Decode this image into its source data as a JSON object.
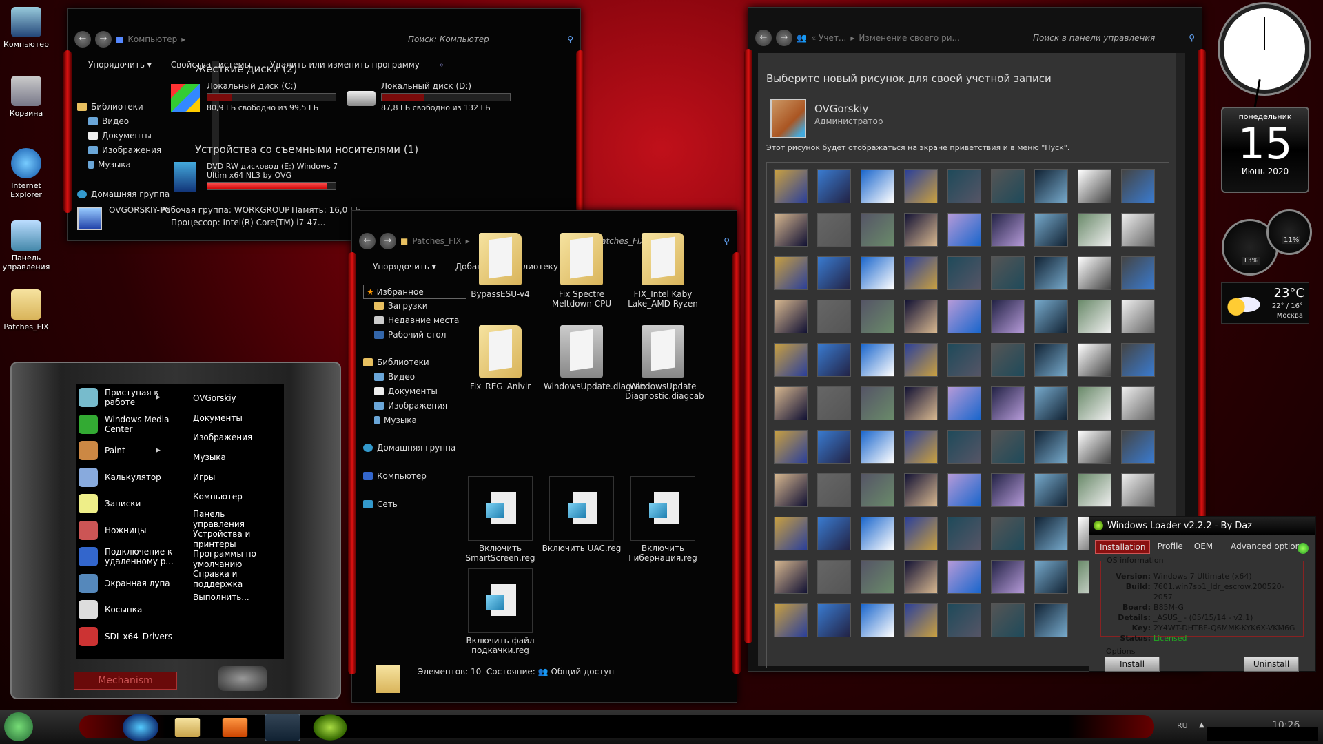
{
  "desktop": {
    "icons": [
      {
        "label": "Компьютер"
      },
      {
        "label": "Корзина"
      },
      {
        "label": "Internet Explorer"
      },
      {
        "label": "Панель управления"
      },
      {
        "label": "Patches_FIX"
      }
    ]
  },
  "computer_window": {
    "breadcrumb": "Компьютер",
    "search_placeholder": "Поиск: Компьютер",
    "toolbar": [
      "Упорядочить ▾",
      "Свойства системы",
      "Удалить или изменить программу",
      "»"
    ],
    "nav": {
      "libraries": "Библиотеки",
      "items": [
        "Видео",
        "Документы",
        "Изображения",
        "Музыка"
      ],
      "homegroup": "Домашняя группа"
    },
    "hard_drives_header": "Жесткие диски (2)",
    "drives": [
      {
        "name": "Локальный диск (C:)",
        "free": "80,9 ГБ свободно из 99,5 ГБ",
        "used_percent": 19
      },
      {
        "name": "Локальный диск (D:)",
        "free": "87,8 ГБ свободно из 132 ГБ",
        "used_percent": 33
      }
    ],
    "removable_header": "Устройства со съемными носителями (1)",
    "dvd": {
      "name": "DVD RW дисковод (E:) Windows 7",
      "name2": "Ultim x64 NL3 by OVG",
      "used_percent": 93
    },
    "details": {
      "pc": "OVGORSKIY-PC",
      "workgroup": "Рабочая группа:  WORKGROUP",
      "memory": "Память: 16,0 ГБ",
      "cpu": "Процессор: Intel(R) Core(TM) i7-47..."
    }
  },
  "start_menu": {
    "programs": [
      "Приступая к работе",
      "Windows Media Center",
      "Paint",
      "Калькулятор",
      "Записки",
      "Ножницы",
      "Подключение к удаленному р...",
      "Экранная лупа",
      "Косынка",
      "SDI_x64_Drivers"
    ],
    "places": [
      "OVGorskiy",
      "Документы",
      "Изображения",
      "Музыка",
      "Игры",
      "Компьютер",
      "Панель управления",
      "Устройства и принтеры",
      "Программы по умолчанию",
      "Справка и поддержка",
      "Выполнить..."
    ],
    "theme_label": "Mechanism"
  },
  "patches_window": {
    "breadcrumb": "Patches_FIX",
    "search_placeholder": "Поиск: Patches_FIX",
    "toolbar": [
      "Упорядочить ▾",
      "Добавить в библиотеку ▾",
      "»"
    ],
    "nav": {
      "favorites": "Избранное",
      "fav_items": [
        "Загрузки",
        "Недавние места",
        "Рабочий стол"
      ],
      "libraries": "Библиотеки",
      "lib_items": [
        "Видео",
        "Документы",
        "Изображения",
        "Музыка"
      ],
      "homegroup": "Домашняя группа",
      "computer": "Компьютер",
      "network": "Сеть"
    },
    "folders": [
      "BypassESU-v4",
      "Fix Spectre Meltdown CPU",
      "FIX_Intel Kaby Lake_AMD Ryzen",
      "Fix_REG_Anivir",
      "WindowsUpdate.diagcab",
      "WindowsUpdate Diagnostic.diagcab"
    ],
    "reg_files": [
      "Включить SmartScreen.reg",
      "Включить UAC.reg",
      "Включить Гибернация.reg",
      "Включить файл подкачки.reg"
    ],
    "status": {
      "count": "Элементов: 10",
      "state_label": "Состояние:",
      "state": "Общий доступ"
    }
  },
  "control_panel": {
    "breadcrumb": [
      "«  Учет...",
      "Изменение своего ри..."
    ],
    "search_placeholder": "Поиск в панели управления",
    "heading": "Выберите новый рисунок для своей учетной записи",
    "user": {
      "name": "OVGorskiy",
      "role": "Администратор"
    },
    "note": "Этот рисунок будет отображаться на экране приветствия и в меню \"Пуск\".",
    "picture_count": 97
  },
  "windows_loader": {
    "title": "Windows Loader v2.2.2 - By Daz",
    "tabs": [
      "Installation",
      "Profile",
      "OEM",
      "Advanced options"
    ],
    "active_tab": "Installation",
    "os_group": "OS information",
    "fields": [
      {
        "k": "Version:",
        "v": "Windows 7 Ultimate (x64)"
      },
      {
        "k": "Build:",
        "v": "7601.win7sp1_ldr_escrow.200520-2057"
      },
      {
        "k": "Board:",
        "v": "B85M-G"
      },
      {
        "k": "Details:",
        "v": "_ASUS_ - (05/15/14 - v2.1)"
      },
      {
        "k": "Key:",
        "v": "2Y4WT-DHTBF-Q6MMK-KYK6X-VKM6G"
      },
      {
        "k": "Status:",
        "v": "Licensed"
      }
    ],
    "options_group": "Options",
    "install": "Install",
    "uninstall": "Uninstall",
    "status_color": "#22aa22"
  },
  "gadgets": {
    "calendar": {
      "weekday": "понедельник",
      "day": "15",
      "month_year": "Июнь 2020"
    },
    "meter": {
      "cpu": "13%",
      "ram": "11%"
    },
    "weather": {
      "temp": "23°C",
      "range": "22° / 16°",
      "city": "Москва"
    }
  },
  "taskbar": {
    "lang": "RU",
    "clock": "10:26"
  },
  "colors": {
    "accent": "#c01018",
    "dark": "#050505"
  }
}
